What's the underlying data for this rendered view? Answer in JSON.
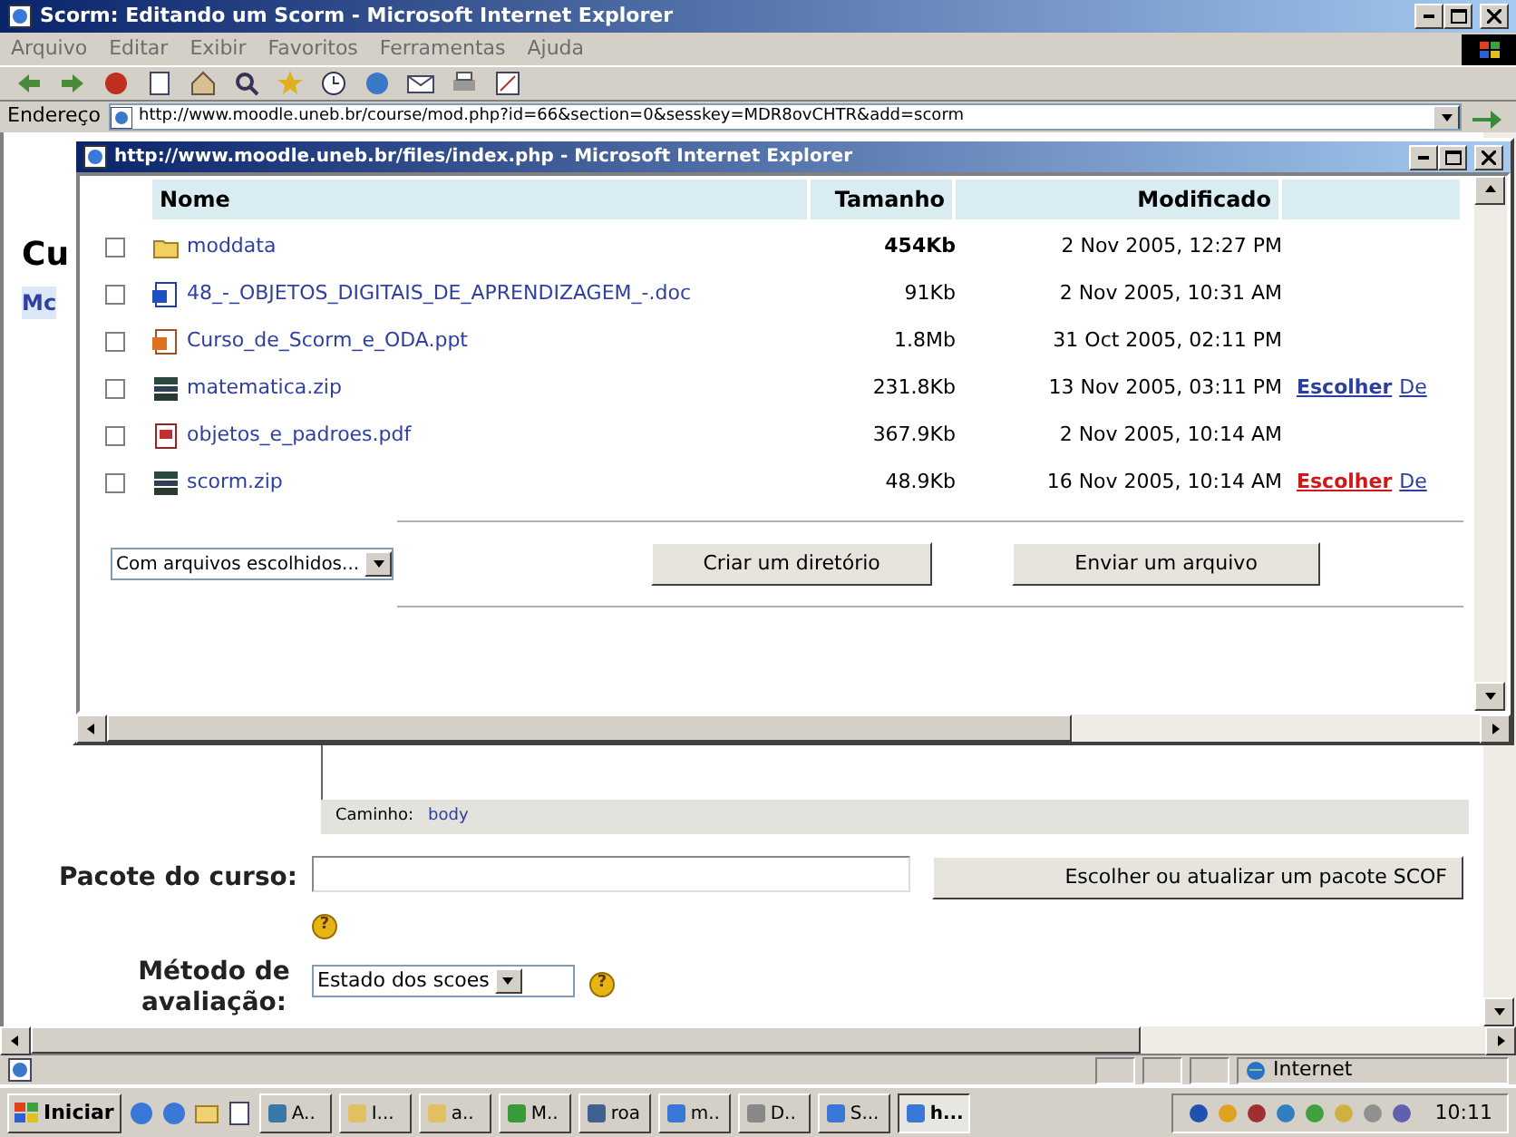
{
  "window": {
    "title": "Scorm: Editando um Scorm - Microsoft Internet Explorer"
  },
  "menu": [
    "Arquivo",
    "Editar",
    "Exibir",
    "Favoritos",
    "Ferramentas",
    "Ajuda"
  ],
  "address_bar": {
    "label": "Endereço",
    "url": "http://www.moodle.uneb.br/course/mod.php?id=66&section=0&sesskey=MDR8ovCHTR&add=scorm"
  },
  "page": {
    "heading": "Cu",
    "link": "Mc",
    "editor_path_label": "Caminho:",
    "editor_path": "body",
    "fields": [
      {
        "kind": "file",
        "label": "Pacote do curso:",
        "button": "Escolher ou atualizar um pacote SCOF",
        "help": "?"
      },
      {
        "kind": "select",
        "label": "Método de avaliação:",
        "value": "Estado dos scoes",
        "help": "?"
      }
    ]
  },
  "popup": {
    "title": "http://www.moodle.uneb.br/files/index.php - Microsoft Internet Explorer",
    "columns": [
      "Nome",
      "Tamanho",
      "Modificado"
    ],
    "rows": [
      {
        "kind": "folder",
        "name": "moddata",
        "size": "454Kb",
        "modified": "2 Nov 2005, 12:27 PM",
        "checked": false,
        "actions": []
      },
      {
        "kind": "doc",
        "name": "48_-_OBJETOS_DIGITAIS_DE_APRENDIZAGEM_-.doc",
        "size": "91Kb",
        "modified": "2 Nov 2005, 10:31 AM",
        "checked": false,
        "actions": []
      },
      {
        "kind": "ppt",
        "name": "Curso_de_Scorm_e_ODA.ppt",
        "size": "1.8Mb",
        "modified": "31 Oct 2005, 02:11 PM",
        "checked": false,
        "actions": []
      },
      {
        "kind": "zip",
        "name": "matematica.zip",
        "size": "231.8Kb",
        "modified": "13 Nov 2005, 03:11 PM",
        "checked": false,
        "actions": [
          {
            "label": "Escolher",
            "hover": false
          },
          {
            "label": "De",
            "hover": false
          }
        ]
      },
      {
        "kind": "pdf",
        "name": "objetos_e_padroes.pdf",
        "size": "367.9Kb",
        "modified": "2 Nov 2005, 10:14 AM",
        "checked": false,
        "actions": []
      },
      {
        "kind": "zip",
        "name": "scorm.zip",
        "size": "48.9Kb",
        "modified": "16 Nov 2005, 10:14 AM",
        "checked": false,
        "actions": [
          {
            "label": "Escolher",
            "hover": true
          },
          {
            "label": "De",
            "hover": false
          }
        ]
      }
    ],
    "bulk_select": "Com arquivos escolhidos...",
    "buttons": [
      "Criar um diretório",
      "Enviar um arquivo"
    ]
  },
  "status_bar": {
    "zone": "Internet"
  },
  "taskbar": {
    "start": "Iniciar",
    "tasks": [
      {
        "label": "A..",
        "selected": false
      },
      {
        "label": "I...",
        "selected": false
      },
      {
        "label": "a..",
        "selected": false
      },
      {
        "label": "M..",
        "selected": false
      },
      {
        "label": "roa",
        "selected": false
      },
      {
        "label": "m..",
        "selected": false
      },
      {
        "label": "D..",
        "selected": false
      },
      {
        "label": "S...",
        "selected": false
      },
      {
        "label": "h...",
        "selected": true
      }
    ],
    "clock": "10:11"
  }
}
